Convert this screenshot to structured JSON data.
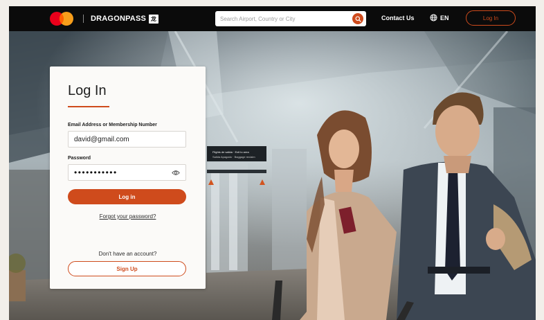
{
  "header": {
    "brand_name": "DRAGONPASS",
    "brand_badge": "龙",
    "search_placeholder": "Search Airport, Country or City",
    "contact_label": "Contact Us",
    "language_label": "EN",
    "login_label": "Log In",
    "icons": {
      "logo": "mastercard-logo",
      "search": "search-icon",
      "language": "globe-icon"
    }
  },
  "hero": {
    "sign_text": "Flights de salida · Exit to area",
    "sign_subtext": "Salida Apagado · Baggage reclaim"
  },
  "login_card": {
    "title": "Log In",
    "email_label": "Email Address or Membership Number",
    "email_value": "david@gmail.com",
    "password_label": "Password",
    "password_value": "•••••••••••",
    "submit_label": "Log in",
    "forgot_label": "Forgot your password?",
    "no_account_text": "Don't have an account?",
    "signup_label": "Sign Up",
    "icons": {
      "password_visibility": "eye-icon"
    }
  },
  "colors": {
    "accent": "#cf4b1c",
    "header_bg": "#0b0b0b",
    "card_bg": "#fbfaf8",
    "mastercard_red": "#eb001b",
    "mastercard_orange": "#f79e1b"
  }
}
